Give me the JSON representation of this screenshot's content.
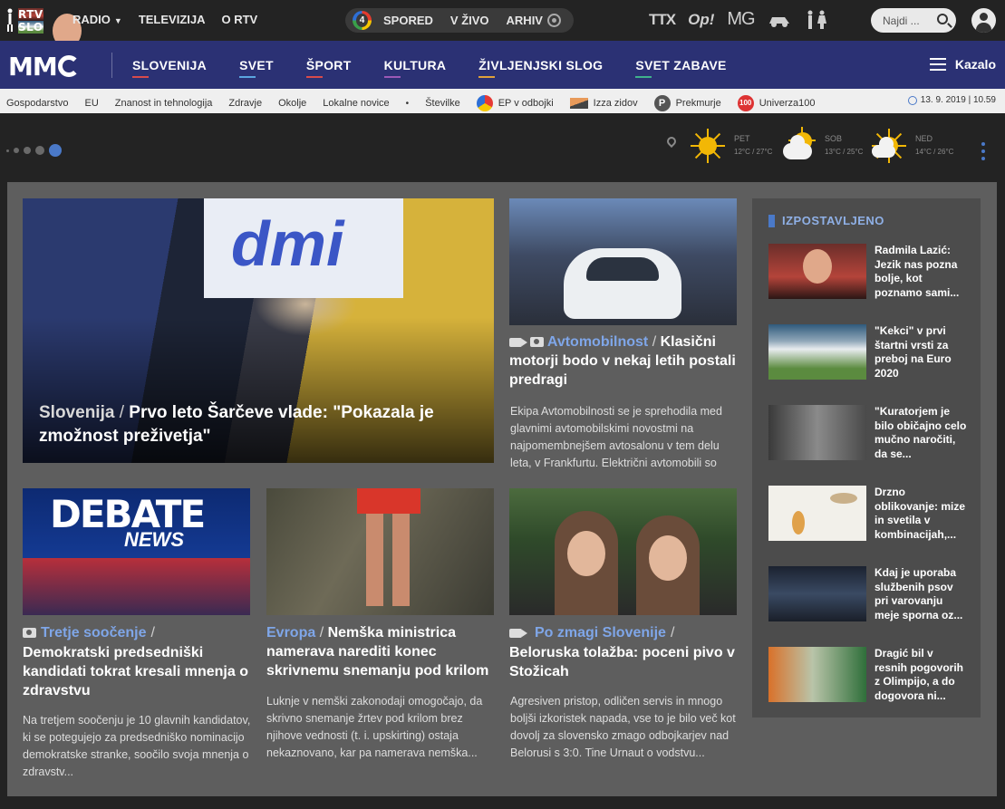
{
  "top": {
    "logo_line1": "RTV",
    "logo_line2": "SLO",
    "nav": [
      {
        "label": "RADIO",
        "has_caret": true
      },
      {
        "label": "TELEVIZIJA"
      },
      {
        "label": "O RTV"
      }
    ],
    "pill": {
      "badge": "4",
      "links": [
        "SPORED",
        "V ŽIVO",
        "ARHIV"
      ]
    },
    "brands": [
      "TTX",
      "Op!",
      "MG",
      "Avto",
      "Dostopno"
    ],
    "search_placeholder": "Najdi ..."
  },
  "main_nav": {
    "logo": "MM",
    "sections": [
      "SLOVENIJA",
      "SVET",
      "ŠPORT",
      "KULTURA",
      "ŽIVLJENJSKI SLOG",
      "SVET ZABAVE"
    ],
    "menu_label": "Kazalo"
  },
  "sub_nav": {
    "items": [
      "Gospodarstvo",
      "EU",
      "Znanost in tehnologija",
      "Zdravje",
      "Okolje",
      "Lokalne novice",
      "•",
      "Številke"
    ],
    "featured": [
      {
        "label": "EP v odbojki",
        "icon": "ep-badge"
      },
      {
        "label": "Izza zidov",
        "icon": "flag-badge"
      },
      {
        "label": "Prekmurje",
        "icon": "p-badge",
        "badge": "P"
      },
      {
        "label": "Univerza100",
        "icon": "u100-badge",
        "badge": "100"
      }
    ],
    "datetime": "13. 9. 2019 | 10.59"
  },
  "weather": [
    {
      "day": "PET",
      "temp": "12°C / 27°C",
      "icon": "sunny"
    },
    {
      "day": "SOB",
      "temp": "13°C / 25°C",
      "icon": "partly-cloudy"
    },
    {
      "day": "NED",
      "temp": "14°C / 26°C",
      "icon": "partly-cloudy"
    }
  ],
  "hero": {
    "category": "Slovenija",
    "title": "Prvo leto Šarčeve vlade: \"Pokazala je zmožnost preživetja\"",
    "banner_text": "dmi"
  },
  "articles": [
    {
      "category": "Avtomobilnost",
      "title": "Klasični motorji bodo v nekaj letih postali predragi",
      "excerpt": "Ekipa Avtomobilnosti se je sprehodila med glavnimi avtomobilskimi novostmi na najpomembnejšem avtosalonu v tem delu leta, v Frankfurtu. Električni avtomobili so",
      "icons": [
        "video",
        "camera"
      ]
    },
    {
      "category": "Tretje soočenje",
      "title": "Demokratski predsedniški kandidati tokrat kresali mnenja o zdravstvu",
      "excerpt": "Na tretjem soočenju je 10 glavnih kandidatov, ki se potegujejo za predsedniško nominacijo demokratske stranke, soočilo svoja mnenja o zdravstv...",
      "icons": [
        "camera"
      ],
      "image_text_1": "DEBATE",
      "image_text_2": "NEWS"
    },
    {
      "category": "Evropa",
      "title": "Nemška ministrica namerava narediti konec skrivnemu snemanju pod krilom",
      "excerpt": "Luknje v nemški zakonodaji omogočajo, da skrivno snemanje žrtev pod krilom brez njihove vednosti (t. i. upskirting) ostaja nekaznovano, kar pa namerava nemška...",
      "icons": []
    },
    {
      "category": "Po zmagi Slovenije",
      "title": "Beloruska tolažba: poceni pivo v Stožicah",
      "excerpt": "Agresiven pristop, odličen servis in mnogo boljši izkoristek napada, vse to je bilo več kot dovolj za slovensko zmago odbojkarjev nad Belorusi s 3:0. Tine Urnaut o vodstvu...",
      "icons": [
        "video"
      ]
    }
  ],
  "sidebar": {
    "heading": "IZPOSTAVLJENO",
    "items": [
      {
        "title": "Radmila Lazić: Jezik nas pozna bolje, kot poznamo sami..."
      },
      {
        "title": "\"Kekci\" v prvi štartni vrsti za preboj na Euro 2020"
      },
      {
        "title": "\"Kuratorjem je bilo običajno celo mučno naročiti, da se..."
      },
      {
        "title": "Drzno oblikovanje: mize in svetila v kombinacijah,..."
      },
      {
        "title": "Kdaj je uporaba službenih psov pri varovanju meje sporna oz..."
      },
      {
        "title": "Dragić bil v resnih pogovorih z Olimpijo, a do dogovora ni..."
      }
    ]
  },
  "colors": {
    "top_bg": "#232323",
    "nav_bg": "#2b3174",
    "category": "#7fa6e8",
    "content_bg": "#5e5e5e",
    "sidebar_bg": "#4c4c4c"
  }
}
